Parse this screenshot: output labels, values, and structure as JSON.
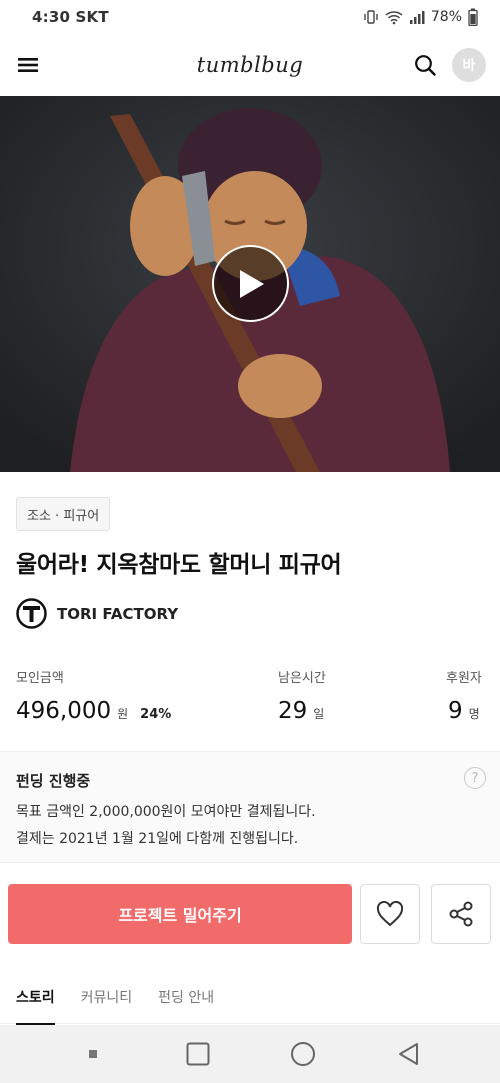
{
  "status_bar": {
    "time_carrier": "4:30 SKT",
    "battery": "78%"
  },
  "header": {
    "logo": "tumblbug",
    "avatar_initial": "바"
  },
  "project": {
    "category": "조소 · 피규어",
    "title": "울어라! 지옥참마도 할머니 피규어",
    "creator": "TORI FACTORY",
    "creator_logo_letter": "T"
  },
  "stats": {
    "raised_label": "모인금액",
    "raised_value": "496,000",
    "raised_unit": "원",
    "raised_percent": "24%",
    "time_left_label": "남은시간",
    "time_left_value": "29",
    "time_left_unit": "일",
    "backers_label": "후원자",
    "backers_value": "9",
    "backers_unit": "명"
  },
  "funding": {
    "status": "펀딩 진행중",
    "line1": "목표 금액인 2,000,000원이 모여야만 결제됩니다.",
    "line2": "결제는 2021년 1월 21일에 다함께 진행됩니다."
  },
  "actions": {
    "back_project_label": "프로젝트 밀어주기"
  },
  "tabs": [
    {
      "label": "스토리",
      "active": true
    },
    {
      "label": "커뮤니티",
      "active": false
    },
    {
      "label": "펀딩 안내",
      "active": false
    }
  ],
  "colors": {
    "accent": "#f26b6b"
  },
  "icons": {
    "menu": "menu-icon",
    "search": "search-icon",
    "play": "play-icon",
    "heart": "heart-icon",
    "share": "share-icon",
    "help": "question-icon"
  }
}
